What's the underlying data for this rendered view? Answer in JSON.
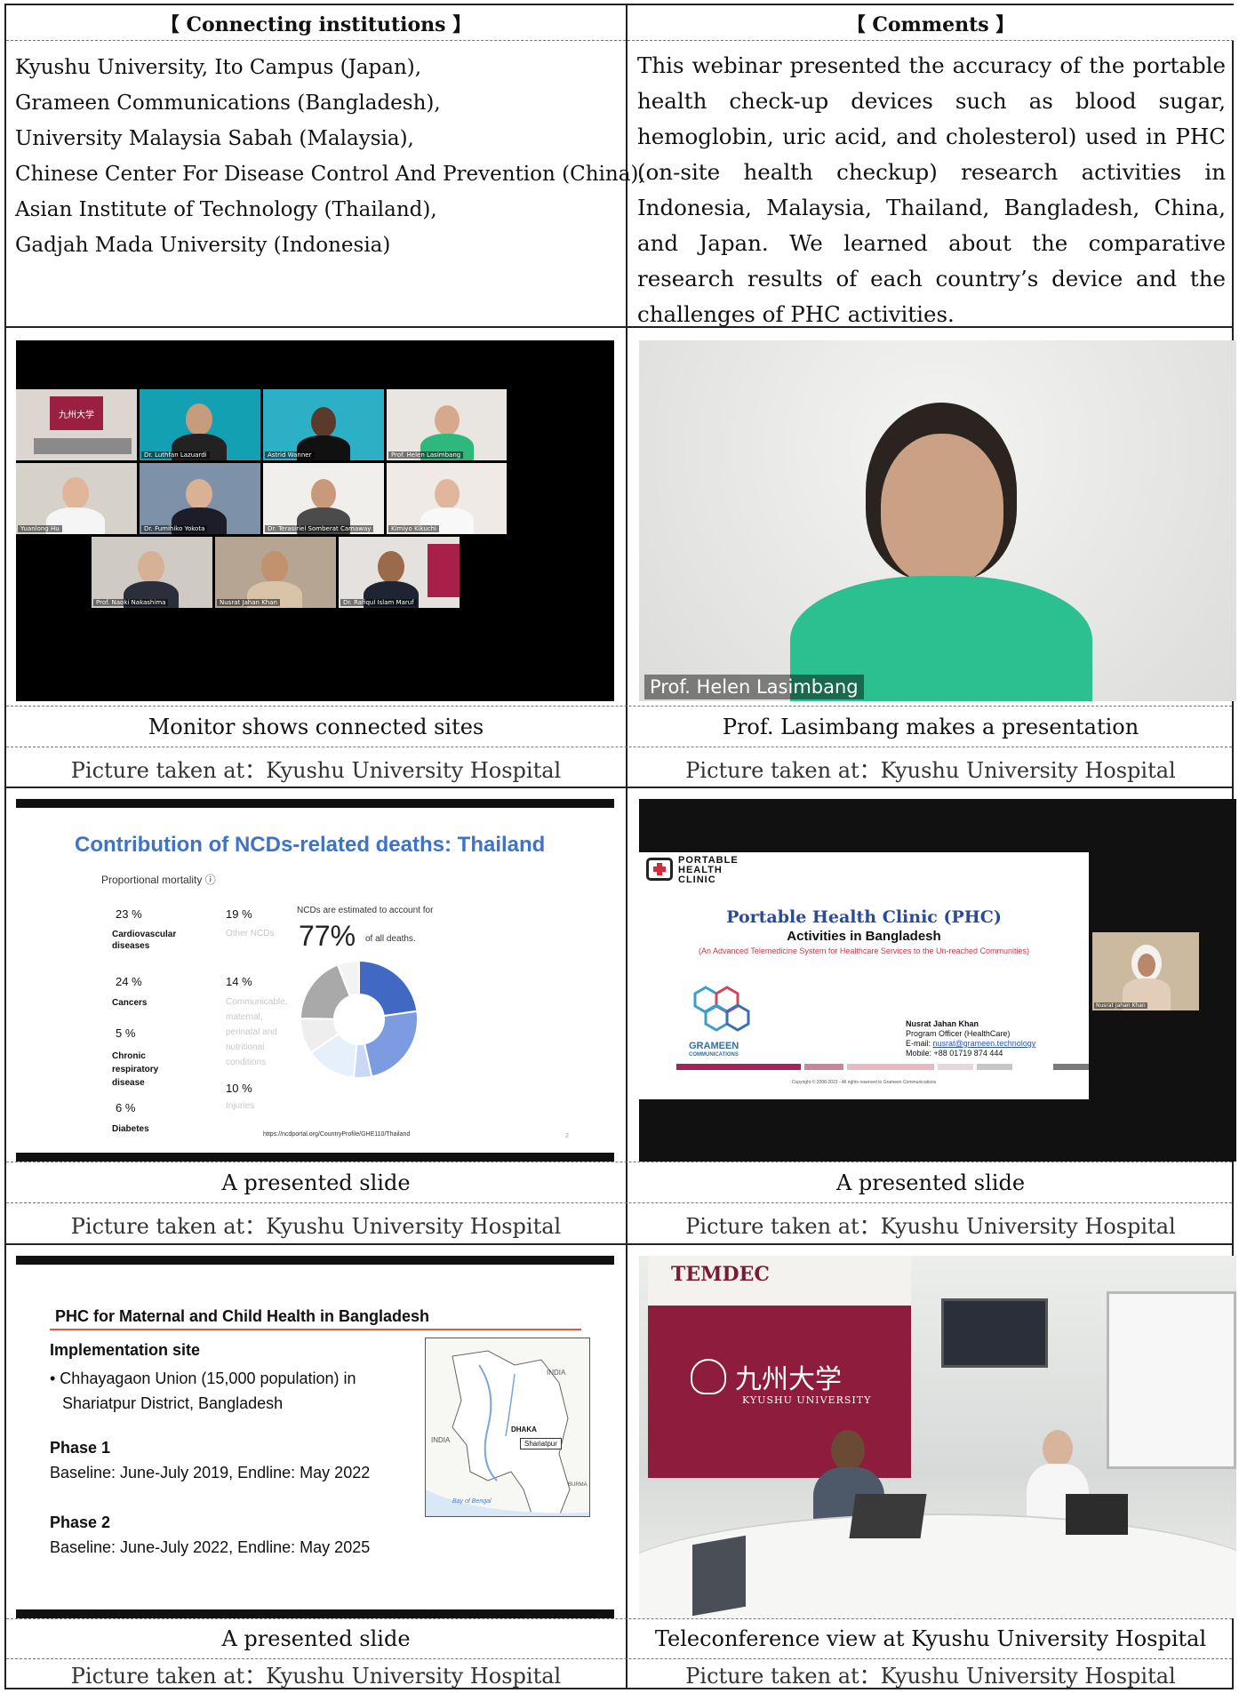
{
  "header": {
    "left": "【 Connecting institutions 】",
    "right": "【 Comments 】"
  },
  "institutions": [
    "Kyushu University, Ito Campus (Japan),",
    "Grameen Communications (Bangladesh),",
    "University Malaysia Sabah (Malaysia),",
    "Chinese Center For Disease Control And Prevention (China),",
    "Asian Institute of Technology (Thailand),",
    "Gadjah Mada University (Indonesia)"
  ],
  "comment": "This webinar presented the accuracy of the portable health check-up devices such as blood sugar, hemoglobin, uric acid, and cholesterol) used in PHC (on-site health checkup) research activities in Indonesia, Malaysia, Thailand, Bangladesh, China, and Japan. We learned about the comparative research results of each country’s device and the challenges of PHC activities.",
  "photos": [
    {
      "caption": "Monitor shows connected sites",
      "taken": "Picture taken at：Kyushu University Hospital"
    },
    {
      "caption": "Prof. Lasimbang makes a presentation",
      "taken": "Picture taken at：Kyushu University Hospital"
    },
    {
      "caption": "A presented slide",
      "taken": "Picture taken at：Kyushu University Hospital"
    },
    {
      "caption": "A presented slide",
      "taken": "Picture taken at：Kyushu University Hospital"
    },
    {
      "caption": "A presented slide",
      "taken": "Picture taken at：Kyushu University Hospital"
    },
    {
      "caption": "Teleconference view at Kyushu University Hospital",
      "taken": "Picture taken at：Kyushu University Hospital"
    }
  ],
  "zoom": {
    "names": [
      "",
      "Dr. Luthfan Lazuardi",
      "Astrid Wanner",
      "Prof. Helen Lasimbang",
      "Yuanlong Hu",
      "Dr. Fumihiko Yokota",
      "Dr. Terasiriel Somberat Camaway",
      "Kimiyo Kikuchi",
      "Prof. Naoki Nakashima",
      "Nusrat Jahan Khan",
      "Dr. Rafiqul Islam Maruf"
    ],
    "speaker_label": "Prof. Helen Lasimbang",
    "logo_jp": "九州大学"
  },
  "slide_thailand": {
    "title": "Contribution of NCDs-related deaths: Thailand",
    "subtitle": "Proportional mortality ⓘ",
    "items": [
      {
        "pct": "23 %",
        "label": "Cardiovascular diseases"
      },
      {
        "pct": "19 %",
        "label": "Other NCDs"
      },
      {
        "pct": "24 %",
        "label": "Cancers"
      },
      {
        "pct": "14 %",
        "label": "Communicable, maternal, perinatal and nutritional conditions"
      },
      {
        "pct": "5 %",
        "label": "Chronic respiratory disease"
      },
      {
        "pct": "10 %",
        "label": "Injuries"
      },
      {
        "pct": "6 %",
        "label": "Diabetes"
      }
    ],
    "ncd_note": "NCDs are estimated to account for",
    "ncd_big": "77%",
    "ncd_tail": "of all deaths.",
    "source": "https://ncdportal.org/CountryProfile/GHE110/Thailand",
    "page": "2",
    "colors": {
      "title": "#3f73c7",
      "dark": "#4169c4",
      "mid": "#7c9be0",
      "light": "#c9d9f5",
      "pale": "#e6f0fa",
      "grey": "#a9a9a9"
    }
  },
  "slide_phc": {
    "logo_line1": "PORTABLE",
    "logo_line2": "HEALTH",
    "logo_line3": "CLINIC",
    "title": "Portable Health Clinic (PHC)",
    "subtitle": "Activities in Bangladesh",
    "tagline": "(An Advanced Telemedicine System for Healthcare Services to the Un-reached Communities)",
    "grameen": "GRAMEEN",
    "grameen_sub": "COMMUNICATIONS",
    "presenter": "Nusrat Jahan Khan",
    "role": "Program Officer (HealthCare)",
    "email_label": "E-mail: ",
    "email": "nusrat@grameen.technology",
    "mobile": "Mobile: +88 01719 874 444",
    "copyright": "Copyright © 2008-2023 - All rights reserved to Grameen Communications"
  },
  "slide_maternal": {
    "title": "PHC for Maternal and Child Health in Bangladesh",
    "impl_head": "Implementation site",
    "impl_line1": "• Chhayagaon Union (15,000 population) in",
    "impl_line2": "Shariatpur District, Bangladesh",
    "phase1": "Phase 1",
    "phase1_text": "Baseline: June-July 2019, Endline: May 2022",
    "phase2": "Phase 2",
    "phase2_text": "Baseline: June-July 2022, Endline: May 2025",
    "map_labels": {
      "india_n": "INDIA",
      "india_w": "INDIA",
      "dhaka": "DHAKA",
      "shariatpur": "Shariatpur",
      "bay": "Bay of Bengal",
      "burma": "BURMA"
    }
  },
  "room": {
    "temdec": "TEMDEC",
    "kanji": "九州大学",
    "english": "KYUSHU UNIVERSITY"
  }
}
